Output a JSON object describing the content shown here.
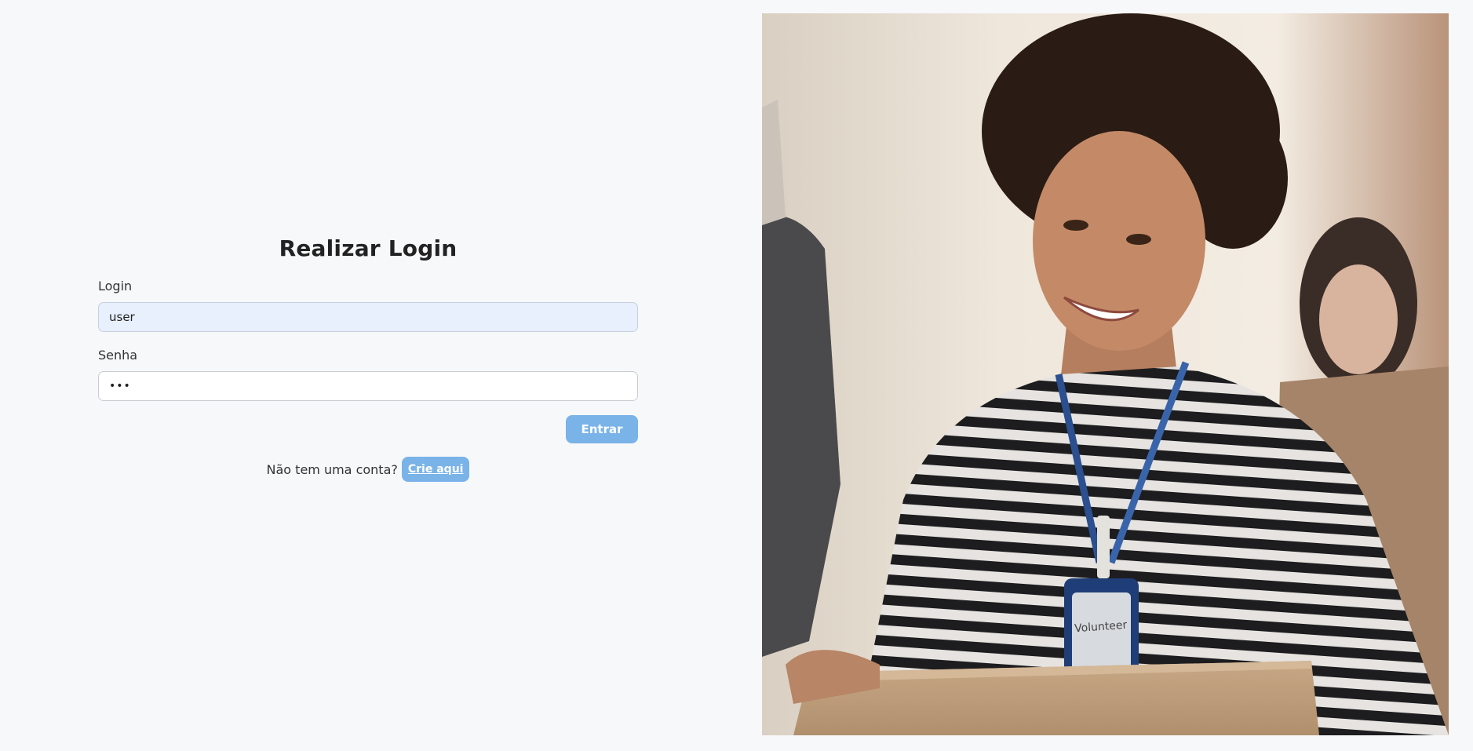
{
  "login": {
    "title": "Realizar Login",
    "login_label": "Login",
    "login_value": "user",
    "password_label": "Senha",
    "password_value": "•••",
    "submit_label": "Entrar",
    "signup_prompt": "Não tem uma conta?",
    "signup_link": "Crie aqui"
  },
  "hero": {
    "badge_text": "Volunteer"
  },
  "colors": {
    "accent": "#7ab3e8",
    "background": "#f7f8fa",
    "autofill": "#e8f0fe"
  }
}
